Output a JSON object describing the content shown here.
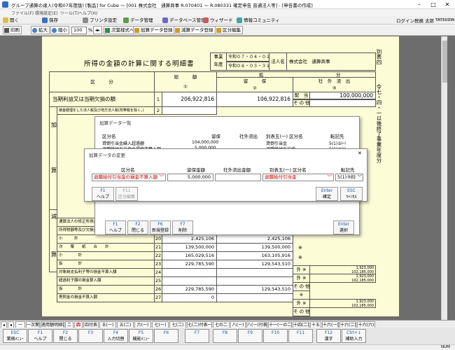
{
  "window": {
    "title": "グループ通算の達人(令和07年度版) [製品] for Cube ～ [001 株式会社　通算商事 R.070401 ～ R.080331 確定申告 普通法人等] - [申告書の作成]"
  },
  "menu": [
    "ファイル(F)",
    "環境設定(E)",
    "ツール(T)",
    "ヘルプ(H)"
  ],
  "toolbar1": {
    "items": [
      "開く",
      "保存",
      "プリンタ設定",
      "データ管理",
      "データベース管理",
      "ウィザード",
      "情報コミュニティ"
    ],
    "login": "ログイン税務 太郎",
    "brand": "TATSUZIN"
  },
  "toolbar2": {
    "print": "印刷",
    "zoom_in": "拡大",
    "zoom_out": "縮小",
    "zoom_value": "100",
    "zoom_unit": "%",
    "next_sheet": "次葉様式へ",
    "add": "加算データ登録",
    "sub": "減算データ登録",
    "split": "区分編集"
  },
  "form": {
    "title": "所得の金額の計算に関する明細書",
    "jigyo1": "事業",
    "jigyo2": "年度",
    "date_from": "令和０７・０４・０１",
    "date_to": "令和０８・０３・３１",
    "corp_label": "法人名",
    "corp_name": "株式会社　通算商事",
    "side_label": "別表四",
    "side_right": "令七・四・一以後終了事業年度分",
    "col_kubun": "区　　　分",
    "col_total": "総　　　額",
    "col_shobun": "処",
    "col_bun": "分",
    "col_ryuho": "留　　　保",
    "col_shagai": "社　外　流　出",
    "c1": "①",
    "c2": "②",
    "c3": "③",
    "yen": "円",
    "row1_label": "当期利益又は当期欠損の額",
    "row1_no": "1",
    "row1_total": "206,922,816",
    "row1_ryuho": "106,922,816",
    "haito": "配　当",
    "haito_amount": "100,000,000",
    "sonota": "そ の 他",
    "add_label1": "加",
    "add_label2": "算",
    "sub_label1": "減",
    "sub_label2": "算",
    "row2_label": "損金経理をした法人税及び地方法人税(附帯税を除く。)",
    "row2_no": "2",
    "rows": [
      {
        "label": "通算法人の修正所得金額等の調整額",
        "no": "18",
        "total": "",
        "ryuho": ""
      },
      {
        "label": "所得税額等及び欠損金の繰戻しによる還付金額等",
        "no": "19",
        "total": "",
        "ryuho": ""
      },
      {
        "label": "小　　　計",
        "no": "20",
        "total": "2,425,106",
        "ryuho": "2,425,106"
      },
      {
        "label": "次　　葉　　紙　　合　　計",
        "no": "21",
        "total": "139,500,000",
        "ryuho": "139,500,000"
      },
      {
        "label": "小　　　　計",
        "no": "22",
        "total": "165,029,516",
        "ryuho": "163,105,916"
      },
      {
        "label": "仮　　　　計",
        "no": "23",
        "total": "229,785,590",
        "ryuho": "129,543,510"
      },
      {
        "label": "対象純支払利子等の損金不算入額",
        "no": "24",
        "total": "",
        "ryuho": ""
      },
      {
        "label": "超過利子額の損金算入額",
        "no": "25",
        "total": "",
        "ryuho": ""
      },
      {
        "label": "仮　　　　計",
        "no": "26",
        "total": "229,785,590",
        "ryuho": "129,543,510"
      },
      {
        "label": "寄附金の損金不算入額",
        "no": "27",
        "total": "0",
        "ryuho": ""
      }
    ],
    "kome": "※",
    "gai": "外 ※",
    "gai_v1": "1,923,000",
    "gai_v2": "102,185,000",
    "gai_v3": "1,923,000",
    "gai_v4": "102,185,000",
    "gai_v5": "1,923,000",
    "gai_v6": "102,185,000"
  },
  "dialog_list": {
    "title": "加算データ一覧",
    "header": [
      "区分名",
      "留保",
      "社外流出",
      "別表五(一) 区分名",
      "転記先"
    ],
    "rows": [
      {
        "name": "貸倒引当金繰入超過額",
        "ryuho": "104,000,000",
        "shagai": "",
        "b5": "貸倒引当金",
        "dest": "5(1)③㈠"
      },
      {
        "name": "退職給付引当金の損金不算入額",
        "ryuho": "5,000,000",
        "shagai": "",
        "b5": "退職給付引当金",
        "dest": "5(1)③㈡"
      }
    ],
    "keys": [
      {
        "f": "F1",
        "l": "ヘルプ"
      },
      {
        "f": "F2",
        "l": "閉じる"
      },
      {
        "f": "F6",
        "l": "新規登録"
      },
      {
        "f": "F7",
        "l": "削除"
      },
      {
        "f": "Enter",
        "l": "選択"
      }
    ]
  },
  "dialog_edit": {
    "title": "加算データの変更",
    "close": "✕",
    "headers": [
      "区分名",
      "留保金額",
      "社外流出金額",
      "別表五(一) 区分名",
      "転記先"
    ],
    "kubun": "退職給付引当金の損金不算入額",
    "ryuho": "5,000,000",
    "shagai": "",
    "b5": "退職給付引当金",
    "dest": "5(1)③㈣",
    "keys": [
      {
        "f": "F1",
        "l": "ヘルプ"
      },
      {
        "f": "F11",
        "l": "区分編集"
      },
      {
        "f": "Enter",
        "l": "確定"
      },
      {
        "f": "ESC",
        "l": "ｷｬﾝｾﾙ"
      }
    ]
  },
  "tabs": [
    "一",
    "一次葉",
    "適用額明細書",
    "二",
    "四",
    "四付表",
    "五(一)",
    "五(二)",
    "六(一)",
    "七(一)",
    "七(二)",
    "七(二)付表一",
    "七の二",
    "八(一)",
    "八(一)付表",
    "十一(一の二)",
    "十四(二)",
    "十五",
    "十六(一)",
    "十六(二)",
    "十六(六)"
  ],
  "fkeys": [
    {
      "f": "ESC",
      "l": "業務ﾒﾆｭｰ"
    },
    {
      "f": "F1",
      "l": "ヘルプ"
    },
    {
      "f": "F2",
      "l": "閉じる"
    },
    {
      "f": "F3",
      "l": ""
    },
    {
      "f": "F4",
      "l": "入力切替"
    },
    {
      "f": "F5",
      "l": "機能ﾒﾆｭｰ"
    },
    {
      "f": "F6",
      "l": ""
    },
    {
      "f": "F7",
      "l": ""
    },
    {
      "f": "F8",
      "l": ""
    },
    {
      "f": "F9",
      "l": ""
    },
    {
      "f": "F10",
      "l": ""
    },
    {
      "f": "F11",
      "l": ""
    },
    {
      "f": "F12",
      "l": "漢字"
    },
    {
      "f": "Ctrl+↓",
      "l": "補助入力"
    }
  ],
  "status": {
    "num": "NUM"
  }
}
